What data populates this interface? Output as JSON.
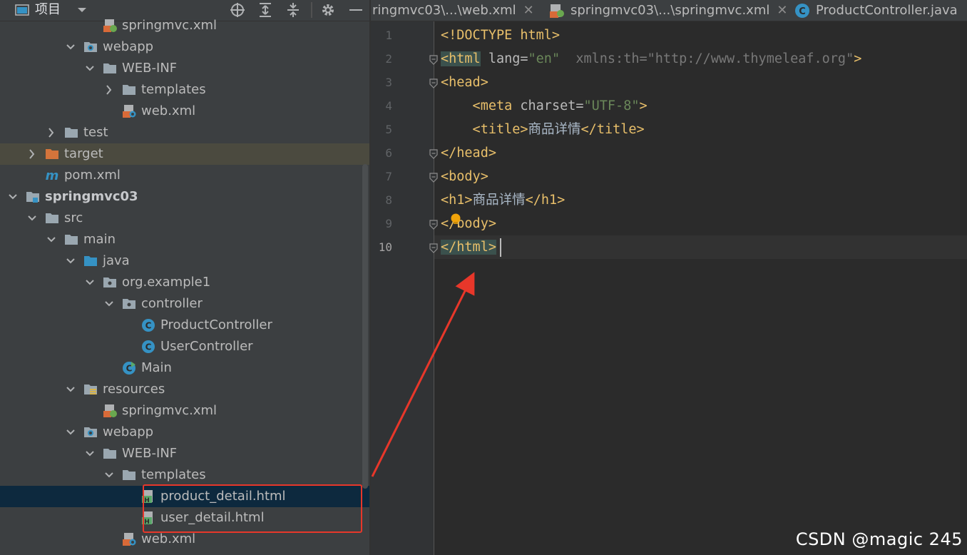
{
  "project_panel": {
    "title": "项目",
    "tree": [
      {
        "label": "springmvc.xml",
        "icon": "spring-xml-icon"
      },
      {
        "label": "webapp",
        "icon": "web-folder-icon"
      },
      {
        "label": "WEB-INF",
        "icon": "folder-icon"
      },
      {
        "label": "templates",
        "icon": "folder-icon"
      },
      {
        "label": "web.xml",
        "icon": "web-xml-icon"
      },
      {
        "label": "test",
        "icon": "folder-icon"
      },
      {
        "label": "target",
        "icon": "excluded-folder-icon"
      },
      {
        "label": "pom.xml",
        "icon": "maven-icon"
      },
      {
        "label": "springmvc03",
        "icon": "module-icon"
      },
      {
        "label": "src",
        "icon": "folder-icon"
      },
      {
        "label": "main",
        "icon": "folder-icon"
      },
      {
        "label": "java",
        "icon": "source-folder-icon"
      },
      {
        "label": "org.example1",
        "icon": "package-icon"
      },
      {
        "label": "controller",
        "icon": "package-icon"
      },
      {
        "label": "ProductController",
        "icon": "class-icon"
      },
      {
        "label": "UserController",
        "icon": "class-icon"
      },
      {
        "label": "Main",
        "icon": "main-class-icon"
      },
      {
        "label": "resources",
        "icon": "resources-folder-icon"
      },
      {
        "label": "springmvc.xml",
        "icon": "spring-xml-icon"
      },
      {
        "label": "webapp",
        "icon": "web-folder-icon"
      },
      {
        "label": "WEB-INF",
        "icon": "folder-icon"
      },
      {
        "label": "templates",
        "icon": "folder-icon"
      },
      {
        "label": "product_detail.html",
        "icon": "html-icon"
      },
      {
        "label": "user_detail.html",
        "icon": "html-icon"
      },
      {
        "label": "web.xml",
        "icon": "web-xml-icon"
      }
    ]
  },
  "tabs": [
    {
      "label": "ringmvc03\\...\\web.xml",
      "icon": "none"
    },
    {
      "label": "springmvc03\\...\\springmvc.xml",
      "icon": "spring-xml-icon"
    },
    {
      "label": "ProductController.java",
      "icon": "class-icon"
    }
  ],
  "editor": {
    "line_numbers": [
      "1",
      "2",
      "3",
      "4",
      "5",
      "6",
      "7",
      "8",
      "9",
      "10"
    ],
    "lines": [
      {
        "parts": [
          {
            "t": "<!DOCTYPE html>",
            "c": "t-tag"
          }
        ]
      },
      {
        "parts": [
          {
            "t": "<html",
            "c": "t-tag match"
          },
          {
            "t": " lang=",
            "c": "t-attr"
          },
          {
            "t": "\"en\"",
            "c": "t-val"
          },
          {
            "t": "  xmlns:th=",
            "c": "t-dim"
          },
          {
            "t": "\"http://www.thymeleaf.org\"",
            "c": "t-dimval"
          },
          {
            "t": ">",
            "c": "t-tag"
          }
        ]
      },
      {
        "parts": [
          {
            "t": "<head>",
            "c": "t-tag"
          }
        ]
      },
      {
        "parts": [
          {
            "t": "    <meta",
            "c": "t-tag"
          },
          {
            "t": " charset=",
            "c": "t-attr"
          },
          {
            "t": "\"UTF-8\"",
            "c": "t-val"
          },
          {
            "t": ">",
            "c": "t-tag"
          }
        ]
      },
      {
        "parts": [
          {
            "t": "    <title>",
            "c": "t-tag"
          },
          {
            "t": "商品详情",
            "c": "t-text"
          },
          {
            "t": "</title>",
            "c": "t-tag"
          }
        ]
      },
      {
        "parts": [
          {
            "t": "</head>",
            "c": "t-tag"
          }
        ]
      },
      {
        "parts": [
          {
            "t": "<body>",
            "c": "t-tag"
          }
        ]
      },
      {
        "parts": [
          {
            "t": "<h1>",
            "c": "t-tag"
          },
          {
            "t": "商品详情",
            "c": "t-text"
          },
          {
            "t": "</h1>",
            "c": "t-tag"
          }
        ]
      },
      {
        "parts": [
          {
            "t": "</body>",
            "c": "t-tag"
          }
        ]
      },
      {
        "parts": [
          {
            "t": "</html>",
            "c": "t-tag match"
          }
        ]
      }
    ]
  },
  "watermark": "CSDN @magic 245",
  "colors": {
    "annotation_red": "#e8372a",
    "selection_bg": "#0d293e",
    "tag": "#e8bf6a",
    "string": "#6a8759"
  }
}
